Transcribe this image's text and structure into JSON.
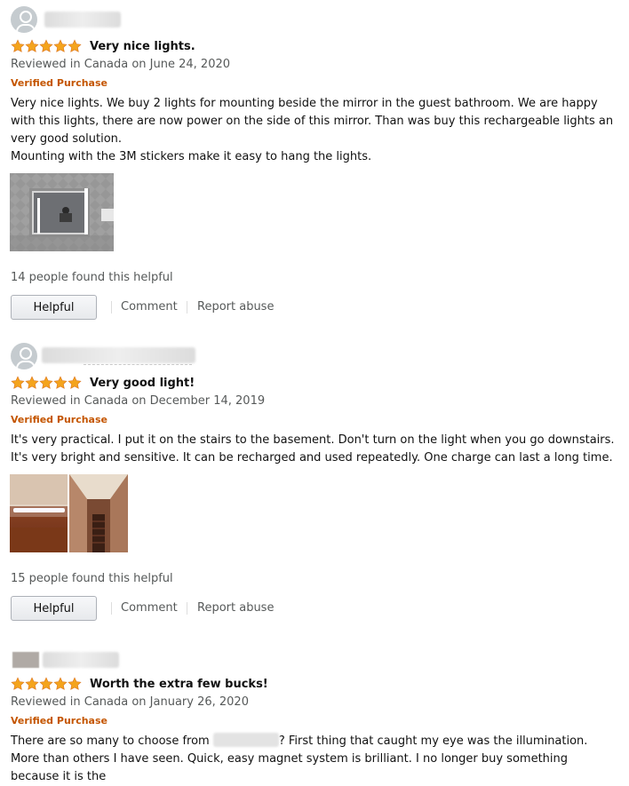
{
  "reviews": [
    {
      "stars": 5,
      "title": "Very nice lights.",
      "meta": "Reviewed in Canada on June 24, 2020",
      "verified": "Verified Purchase",
      "body": [
        "Very nice lights. We buy 2 lights for mounting beside the mirror in the guest bathroom. We are happy with this lights, there are now power on the side of this mirror. Than was buy this rechargeable lights an very good solution.",
        "Mounting with the 3M stickers make it easy to hang the lights."
      ],
      "helpful": "14 people found this helpful",
      "helpful_button": "Helpful",
      "comment": "Comment",
      "report": "Report abuse"
    },
    {
      "stars": 5,
      "title": "Very good light!",
      "meta": "Reviewed in Canada on December 14, 2019",
      "verified": "Verified Purchase",
      "body": [
        "It's very practical. I put it on the stairs to the basement. Don't turn on the light when you go downstairs. It's very bright and sensitive. It can be recharged and used repeatedly. One charge can last a long time."
      ],
      "helpful": "15 people found this helpful",
      "helpful_button": "Helpful",
      "comment": "Comment",
      "report": "Report abuse"
    },
    {
      "stars": 5,
      "title": "Worth the extra few bucks!",
      "meta": "Reviewed in Canada on January 26, 2020",
      "verified": "Verified Purchase",
      "body_a": "There are so many to choose from",
      "body_b": "? First thing that caught my eye was the illumination. More than others I have seen. Quick, easy magnet system is brilliant. I no longer buy something because it is the"
    }
  ],
  "colors": {
    "star": "#f4a41d",
    "verified": "#c45500",
    "meta": "#565959"
  },
  "icons": [
    "avatar-icon",
    "star-icon"
  ]
}
